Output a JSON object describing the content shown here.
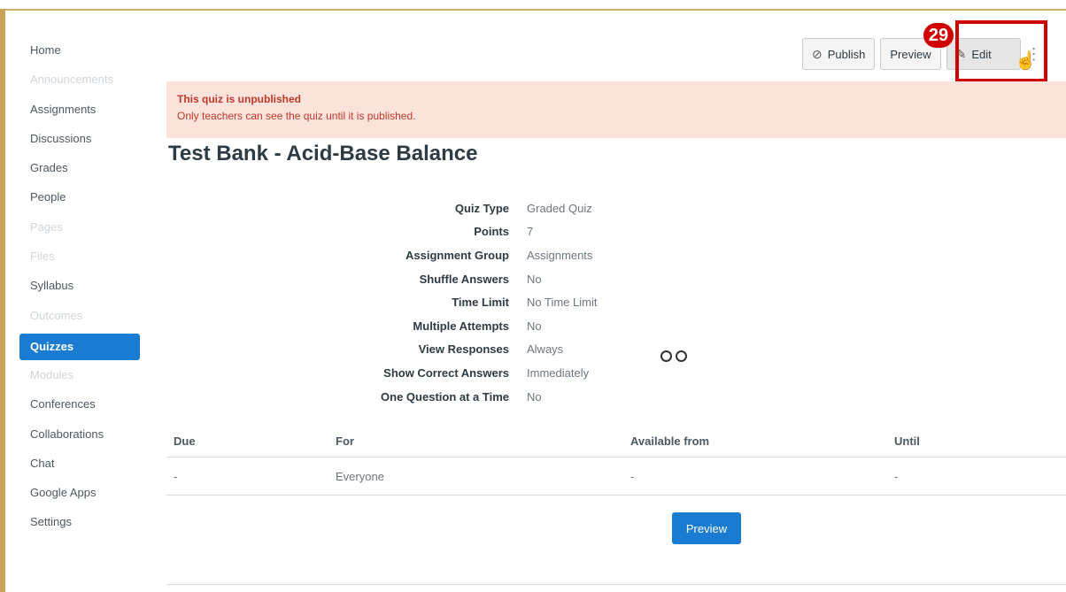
{
  "sidebar": {
    "items": [
      {
        "label": "Home",
        "state": "normal"
      },
      {
        "label": "Announcements",
        "state": "disabled"
      },
      {
        "label": "Assignments",
        "state": "normal"
      },
      {
        "label": "Discussions",
        "state": "normal"
      },
      {
        "label": "Grades",
        "state": "normal"
      },
      {
        "label": "People",
        "state": "normal"
      },
      {
        "label": "Pages",
        "state": "disabled"
      },
      {
        "label": "Files",
        "state": "disabled"
      },
      {
        "label": "Syllabus",
        "state": "normal"
      },
      {
        "label": "Outcomes",
        "state": "disabled"
      },
      {
        "label": "Quizzes",
        "state": "active"
      },
      {
        "label": "Modules",
        "state": "disabled"
      },
      {
        "label": "Conferences",
        "state": "normal"
      },
      {
        "label": "Collaborations",
        "state": "normal"
      },
      {
        "label": "Chat",
        "state": "normal"
      },
      {
        "label": "Google Apps",
        "state": "normal"
      },
      {
        "label": "Settings",
        "state": "normal"
      }
    ]
  },
  "header": {
    "publish_label": "Publish",
    "preview_label": "Preview",
    "edit_label": "Edit",
    "step_badge": "29"
  },
  "alert": {
    "title": "This quiz is unpublished",
    "text": "Only teachers can see the quiz until it is published."
  },
  "quiz": {
    "title": "Test Bank - Acid-Base Balance",
    "details": [
      {
        "label": "Quiz Type",
        "value": "Graded Quiz"
      },
      {
        "label": "Points",
        "value": "7"
      },
      {
        "label": "Assignment Group",
        "value": "Assignments"
      },
      {
        "label": "Shuffle Answers",
        "value": "No"
      },
      {
        "label": "Time Limit",
        "value": "No Time Limit"
      },
      {
        "label": "Multiple Attempts",
        "value": "No"
      },
      {
        "label": "View Responses",
        "value": "Always"
      },
      {
        "label": "Show Correct Answers",
        "value": "Immediately"
      },
      {
        "label": "One Question at a Time",
        "value": "No"
      }
    ]
  },
  "due_table": {
    "headers": [
      "Due",
      "For",
      "Available from",
      "Until"
    ],
    "row": [
      "-",
      "Everyone",
      "-",
      "-"
    ]
  },
  "preview_button_label": "Preview",
  "colors": {
    "accent": "#1a7bd2",
    "alert_bg": "#fbe3dc",
    "alert_text": "#c0392b",
    "highlight": "#d00000"
  }
}
